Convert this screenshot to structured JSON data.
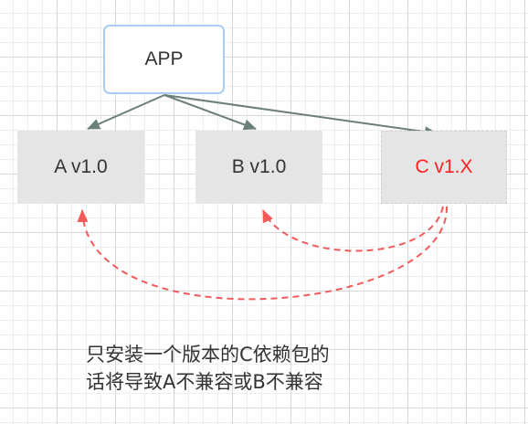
{
  "nodes": {
    "app": "APP",
    "a": "A v1.0",
    "b": "B v1.0",
    "c": "C v1.X"
  },
  "caption": {
    "line1": "只安装一个版本的C依赖包的",
    "line2": "话将导致A不兼容或B不兼容"
  },
  "colors": {
    "solid_edge": "#6b7f7b",
    "conflict_edge": "#f25a5a",
    "c_label": "#ff2020",
    "app_border": "#a9cdf1",
    "lib_fill": "#e5e5e5"
  }
}
